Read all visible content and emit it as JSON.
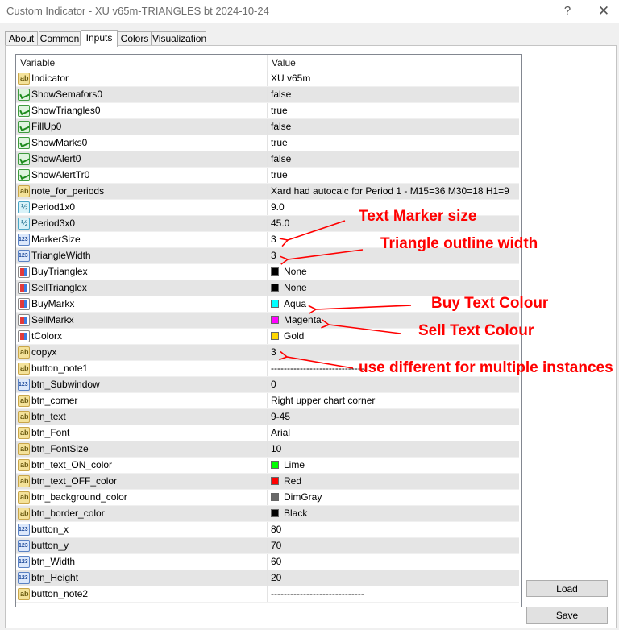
{
  "window": {
    "title": "Custom Indicator - XU v65m-TRIANGLES bt 2024-10-24",
    "help_glyph": "?",
    "close_glyph": "✕"
  },
  "tabs": [
    "About",
    "Common",
    "Inputs",
    "Colors",
    "Visualization"
  ],
  "active_tab": "Inputs",
  "grid": {
    "header": {
      "variable": "Variable",
      "value": "Value"
    },
    "rows": [
      {
        "icon": "text-icon",
        "name": "Indicator",
        "value": "XU v65m"
      },
      {
        "icon": "boolean-icon",
        "name": "ShowSemafors0",
        "value": "false"
      },
      {
        "icon": "boolean-icon",
        "name": "ShowTriangles0",
        "value": "true"
      },
      {
        "icon": "boolean-icon",
        "name": "FillUp0",
        "value": "false"
      },
      {
        "icon": "boolean-icon",
        "name": "ShowMarks0",
        "value": "true"
      },
      {
        "icon": "boolean-icon",
        "name": "ShowAlert0",
        "value": "false"
      },
      {
        "icon": "boolean-icon",
        "name": "ShowAlertTr0",
        "value": "true"
      },
      {
        "icon": "text-icon",
        "name": "note_for_periods",
        "value": "Xard had autocalc for Period 1 - M15=36 M30=18 H1=9"
      },
      {
        "icon": "double-icon",
        "name": "Period1x0",
        "value": "9.0"
      },
      {
        "icon": "double-icon",
        "name": "Period3x0",
        "value": "45.0"
      },
      {
        "icon": "integer-icon",
        "name": "MarkerSize",
        "value": "3"
      },
      {
        "icon": "integer-icon",
        "name": "TriangleWidth",
        "value": "3"
      },
      {
        "icon": "color-icon",
        "name": "BuyTrianglex",
        "value": "None",
        "swatch": "#000000"
      },
      {
        "icon": "color-icon",
        "name": "SellTrianglex",
        "value": "None",
        "swatch": "#000000"
      },
      {
        "icon": "color-icon",
        "name": "BuyMarkx",
        "value": "Aqua",
        "swatch": "#00ffff"
      },
      {
        "icon": "color-icon",
        "name": "SellMarkx",
        "value": "Magenta",
        "swatch": "#ff00ff"
      },
      {
        "icon": "color-icon",
        "name": "tColorx",
        "value": "Gold",
        "swatch": "#ffd700"
      },
      {
        "icon": "text-icon",
        "name": "copyx",
        "value": "3"
      },
      {
        "icon": "text-icon",
        "name": "button_note1",
        "value": "-----------------------------"
      },
      {
        "icon": "integer-icon",
        "name": "btn_Subwindow",
        "value": "0"
      },
      {
        "icon": "text-icon",
        "name": "btn_corner",
        "value": "Right upper chart corner"
      },
      {
        "icon": "text-icon",
        "name": "btn_text",
        "value": "9-45"
      },
      {
        "icon": "text-icon",
        "name": "btn_Font",
        "value": "Arial"
      },
      {
        "icon": "text-icon",
        "name": "btn_FontSize",
        "value": "10"
      },
      {
        "icon": "text-icon",
        "name": "btn_text_ON_color",
        "value": "Lime",
        "swatch": "#00ff00"
      },
      {
        "icon": "text-icon",
        "name": "btn_text_OFF_color",
        "value": "Red",
        "swatch": "#ff0000"
      },
      {
        "icon": "text-icon",
        "name": "btn_background_color",
        "value": "DimGray",
        "swatch": "#696969"
      },
      {
        "icon": "text-icon",
        "name": "btn_border_color",
        "value": "Black",
        "swatch": "#000000"
      },
      {
        "icon": "integer-icon",
        "name": "button_x",
        "value": "80"
      },
      {
        "icon": "integer-icon",
        "name": "button_y",
        "value": "70"
      },
      {
        "icon": "integer-icon",
        "name": "btn_Width",
        "value": "60"
      },
      {
        "icon": "integer-icon",
        "name": "btn_Height",
        "value": "20"
      },
      {
        "icon": "text-icon",
        "name": "button_note2",
        "value": "-----------------------------"
      }
    ]
  },
  "buttons": {
    "load": "Load",
    "save": "Save"
  },
  "annotations": {
    "marker_size": "Text Marker size",
    "triangle_width": "Triangle outline width",
    "buy_colour": "Buy Text Colour",
    "sell_colour": "Sell Text Colour",
    "copyx": "use different for multiple instances"
  },
  "colors": {
    "annotation": "#ff0000",
    "selected_row": "#e5e5e5"
  }
}
